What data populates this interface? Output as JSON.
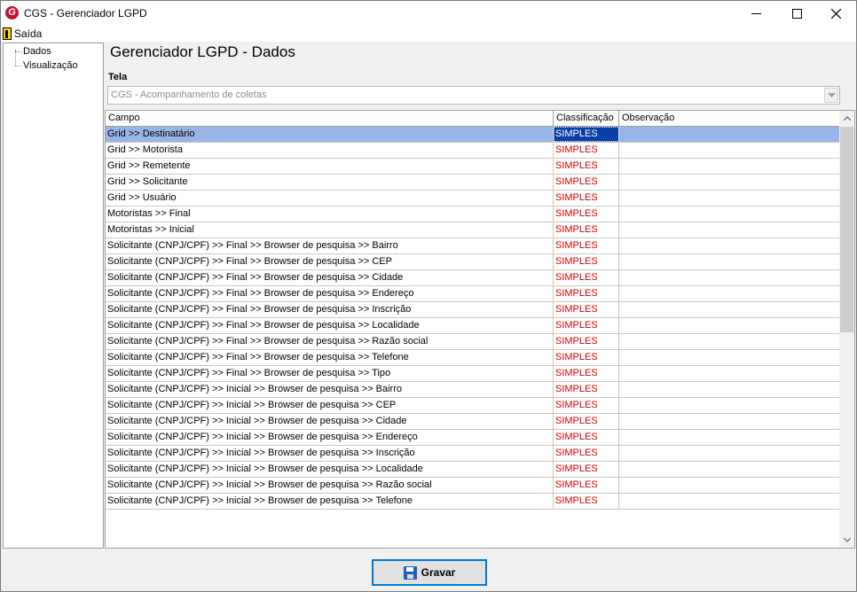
{
  "window": {
    "title": "CGS - Gerenciador LGPD",
    "icon": "cgs-logo-icon",
    "controls": [
      "minimize-icon",
      "maximize-icon",
      "close-icon"
    ]
  },
  "menu": {
    "exit_label": "Saída",
    "exit_icon": "exit-door-icon"
  },
  "sidebar": {
    "items": [
      {
        "label": "Dados"
      },
      {
        "label": "Visualização"
      }
    ]
  },
  "main": {
    "heading": "Gerenciador LGPD - Dados",
    "tela_label": "Tela",
    "tela_value": "CGS - Acompanhamento de coletas"
  },
  "grid": {
    "columns": [
      "Campo",
      "Classificação",
      "Observação"
    ],
    "selected_index": 0,
    "rows": [
      {
        "campo": "Grid >> Destinatário",
        "classificacao": "SIMPLES",
        "observacao": ""
      },
      {
        "campo": "Grid >> Motorista",
        "classificacao": "SIMPLES",
        "observacao": ""
      },
      {
        "campo": "Grid >> Remetente",
        "classificacao": "SIMPLES",
        "observacao": ""
      },
      {
        "campo": "Grid >> Solicitante",
        "classificacao": "SIMPLES",
        "observacao": ""
      },
      {
        "campo": "Grid >> Usuário",
        "classificacao": "SIMPLES",
        "observacao": ""
      },
      {
        "campo": "Motoristas >> Final",
        "classificacao": "SIMPLES",
        "observacao": ""
      },
      {
        "campo": "Motoristas >> Inicial",
        "classificacao": "SIMPLES",
        "observacao": ""
      },
      {
        "campo": "Solicitante (CNPJ/CPF) >> Final >> Browser de pesquisa >> Bairro",
        "classificacao": "SIMPLES",
        "observacao": ""
      },
      {
        "campo": "Solicitante (CNPJ/CPF) >> Final >> Browser de pesquisa >> CEP",
        "classificacao": "SIMPLES",
        "observacao": ""
      },
      {
        "campo": "Solicitante (CNPJ/CPF) >> Final >> Browser de pesquisa >> Cidade",
        "classificacao": "SIMPLES",
        "observacao": ""
      },
      {
        "campo": "Solicitante (CNPJ/CPF) >> Final >> Browser de pesquisa >> Endereço",
        "classificacao": "SIMPLES",
        "observacao": ""
      },
      {
        "campo": "Solicitante (CNPJ/CPF) >> Final >> Browser de pesquisa >> Inscrição",
        "classificacao": "SIMPLES",
        "observacao": ""
      },
      {
        "campo": "Solicitante (CNPJ/CPF) >> Final >> Browser de pesquisa >> Localidade",
        "classificacao": "SIMPLES",
        "observacao": ""
      },
      {
        "campo": "Solicitante (CNPJ/CPF) >> Final >> Browser de pesquisa >> Razão social",
        "classificacao": "SIMPLES",
        "observacao": ""
      },
      {
        "campo": "Solicitante (CNPJ/CPF) >> Final >> Browser de pesquisa >> Telefone",
        "classificacao": "SIMPLES",
        "observacao": ""
      },
      {
        "campo": "Solicitante (CNPJ/CPF) >> Final >> Browser de pesquisa >> Tipo",
        "classificacao": "SIMPLES",
        "observacao": ""
      },
      {
        "campo": "Solicitante (CNPJ/CPF) >> Inicial >> Browser de pesquisa >> Bairro",
        "classificacao": "SIMPLES",
        "observacao": ""
      },
      {
        "campo": "Solicitante (CNPJ/CPF) >> Inicial >> Browser de pesquisa >> CEP",
        "classificacao": "SIMPLES",
        "observacao": ""
      },
      {
        "campo": "Solicitante (CNPJ/CPF) >> Inicial >> Browser de pesquisa >> Cidade",
        "classificacao": "SIMPLES",
        "observacao": ""
      },
      {
        "campo": "Solicitante (CNPJ/CPF) >> Inicial >> Browser de pesquisa >> Endereço",
        "classificacao": "SIMPLES",
        "observacao": ""
      },
      {
        "campo": "Solicitante (CNPJ/CPF) >> Inicial >> Browser de pesquisa >> Inscrição",
        "classificacao": "SIMPLES",
        "observacao": ""
      },
      {
        "campo": "Solicitante (CNPJ/CPF) >> Inicial >> Browser de pesquisa >> Localidade",
        "classificacao": "SIMPLES",
        "observacao": ""
      },
      {
        "campo": "Solicitante (CNPJ/CPF) >> Inicial >> Browser de pesquisa >> Razão social",
        "classificacao": "SIMPLES",
        "observacao": ""
      },
      {
        "campo": "Solicitante (CNPJ/CPF) >> Inicial >> Browser de pesquisa >> Telefone",
        "classificacao": "SIMPLES",
        "observacao": ""
      }
    ]
  },
  "footer": {
    "save_label": "Gravar",
    "save_icon": "floppy-disk-icon"
  },
  "colors": {
    "selected_row": "#99b4e8",
    "selected_cell": "#0a3fa8",
    "classification_text": "#d40000",
    "button_border": "#0078d7"
  }
}
